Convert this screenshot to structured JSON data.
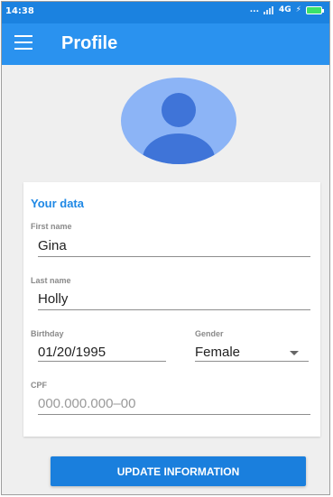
{
  "status_bar": {
    "time": "14:38",
    "icons_text": "... ",
    "network": "4G"
  },
  "app_bar": {
    "title": "Profile",
    "menu_icon": "hamburger-menu-icon"
  },
  "avatar": {
    "icon": "account-circle-icon",
    "background_color": "#8cb4f6",
    "figure_color": "#3f74d8"
  },
  "form": {
    "section_title": "Your data",
    "first_name": {
      "label": "First name",
      "value": "Gina"
    },
    "last_name": {
      "label": "Last name",
      "value": "Holly"
    },
    "birthday": {
      "label": "Birthday",
      "value": "01/20/1995"
    },
    "gender": {
      "label": "Gender",
      "value": "Female"
    },
    "cpf": {
      "label": "CPF",
      "placeholder": "000.000.000–00"
    }
  },
  "actions": {
    "update_label": "UPDATE INFORMATION"
  },
  "colors": {
    "status_bar": "#1b82e0",
    "app_bar": "#2a92ef",
    "accent": "#1e88e5",
    "button": "#1a7fdd"
  }
}
